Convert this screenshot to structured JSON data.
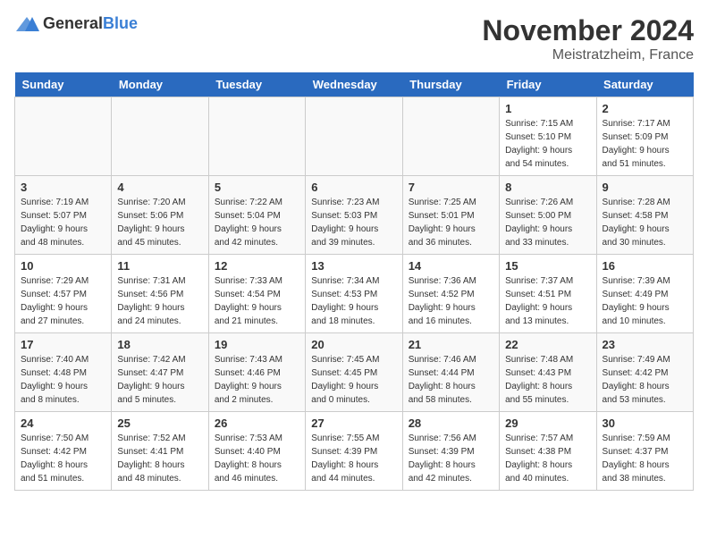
{
  "logo": {
    "general": "General",
    "blue": "Blue"
  },
  "title": "November 2024",
  "location": "Meistratzheim, France",
  "days_of_week": [
    "Sunday",
    "Monday",
    "Tuesday",
    "Wednesday",
    "Thursday",
    "Friday",
    "Saturday"
  ],
  "weeks": [
    [
      {
        "day": "",
        "info": ""
      },
      {
        "day": "",
        "info": ""
      },
      {
        "day": "",
        "info": ""
      },
      {
        "day": "",
        "info": ""
      },
      {
        "day": "",
        "info": ""
      },
      {
        "day": "1",
        "info": "Sunrise: 7:15 AM\nSunset: 5:10 PM\nDaylight: 9 hours\nand 54 minutes."
      },
      {
        "day": "2",
        "info": "Sunrise: 7:17 AM\nSunset: 5:09 PM\nDaylight: 9 hours\nand 51 minutes."
      }
    ],
    [
      {
        "day": "3",
        "info": "Sunrise: 7:19 AM\nSunset: 5:07 PM\nDaylight: 9 hours\nand 48 minutes."
      },
      {
        "day": "4",
        "info": "Sunrise: 7:20 AM\nSunset: 5:06 PM\nDaylight: 9 hours\nand 45 minutes."
      },
      {
        "day": "5",
        "info": "Sunrise: 7:22 AM\nSunset: 5:04 PM\nDaylight: 9 hours\nand 42 minutes."
      },
      {
        "day": "6",
        "info": "Sunrise: 7:23 AM\nSunset: 5:03 PM\nDaylight: 9 hours\nand 39 minutes."
      },
      {
        "day": "7",
        "info": "Sunrise: 7:25 AM\nSunset: 5:01 PM\nDaylight: 9 hours\nand 36 minutes."
      },
      {
        "day": "8",
        "info": "Sunrise: 7:26 AM\nSunset: 5:00 PM\nDaylight: 9 hours\nand 33 minutes."
      },
      {
        "day": "9",
        "info": "Sunrise: 7:28 AM\nSunset: 4:58 PM\nDaylight: 9 hours\nand 30 minutes."
      }
    ],
    [
      {
        "day": "10",
        "info": "Sunrise: 7:29 AM\nSunset: 4:57 PM\nDaylight: 9 hours\nand 27 minutes."
      },
      {
        "day": "11",
        "info": "Sunrise: 7:31 AM\nSunset: 4:56 PM\nDaylight: 9 hours\nand 24 minutes."
      },
      {
        "day": "12",
        "info": "Sunrise: 7:33 AM\nSunset: 4:54 PM\nDaylight: 9 hours\nand 21 minutes."
      },
      {
        "day": "13",
        "info": "Sunrise: 7:34 AM\nSunset: 4:53 PM\nDaylight: 9 hours\nand 18 minutes."
      },
      {
        "day": "14",
        "info": "Sunrise: 7:36 AM\nSunset: 4:52 PM\nDaylight: 9 hours\nand 16 minutes."
      },
      {
        "day": "15",
        "info": "Sunrise: 7:37 AM\nSunset: 4:51 PM\nDaylight: 9 hours\nand 13 minutes."
      },
      {
        "day": "16",
        "info": "Sunrise: 7:39 AM\nSunset: 4:49 PM\nDaylight: 9 hours\nand 10 minutes."
      }
    ],
    [
      {
        "day": "17",
        "info": "Sunrise: 7:40 AM\nSunset: 4:48 PM\nDaylight: 9 hours\nand 8 minutes."
      },
      {
        "day": "18",
        "info": "Sunrise: 7:42 AM\nSunset: 4:47 PM\nDaylight: 9 hours\nand 5 minutes."
      },
      {
        "day": "19",
        "info": "Sunrise: 7:43 AM\nSunset: 4:46 PM\nDaylight: 9 hours\nand 2 minutes."
      },
      {
        "day": "20",
        "info": "Sunrise: 7:45 AM\nSunset: 4:45 PM\nDaylight: 9 hours\nand 0 minutes."
      },
      {
        "day": "21",
        "info": "Sunrise: 7:46 AM\nSunset: 4:44 PM\nDaylight: 8 hours\nand 58 minutes."
      },
      {
        "day": "22",
        "info": "Sunrise: 7:48 AM\nSunset: 4:43 PM\nDaylight: 8 hours\nand 55 minutes."
      },
      {
        "day": "23",
        "info": "Sunrise: 7:49 AM\nSunset: 4:42 PM\nDaylight: 8 hours\nand 53 minutes."
      }
    ],
    [
      {
        "day": "24",
        "info": "Sunrise: 7:50 AM\nSunset: 4:42 PM\nDaylight: 8 hours\nand 51 minutes."
      },
      {
        "day": "25",
        "info": "Sunrise: 7:52 AM\nSunset: 4:41 PM\nDaylight: 8 hours\nand 48 minutes."
      },
      {
        "day": "26",
        "info": "Sunrise: 7:53 AM\nSunset: 4:40 PM\nDaylight: 8 hours\nand 46 minutes."
      },
      {
        "day": "27",
        "info": "Sunrise: 7:55 AM\nSunset: 4:39 PM\nDaylight: 8 hours\nand 44 minutes."
      },
      {
        "day": "28",
        "info": "Sunrise: 7:56 AM\nSunset: 4:39 PM\nDaylight: 8 hours\nand 42 minutes."
      },
      {
        "day": "29",
        "info": "Sunrise: 7:57 AM\nSunset: 4:38 PM\nDaylight: 8 hours\nand 40 minutes."
      },
      {
        "day": "30",
        "info": "Sunrise: 7:59 AM\nSunset: 4:37 PM\nDaylight: 8 hours\nand 38 minutes."
      }
    ]
  ]
}
